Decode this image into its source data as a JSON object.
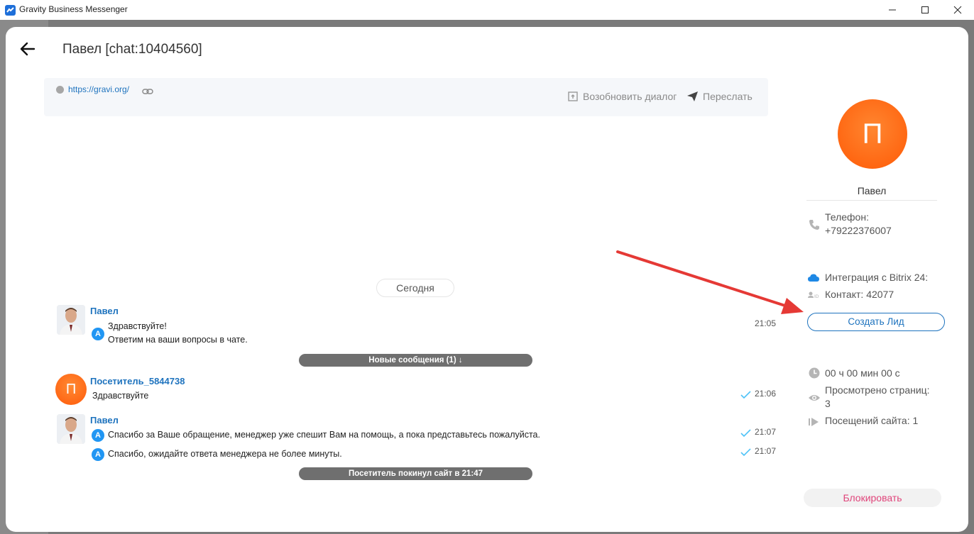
{
  "window": {
    "title": "Gravity Business Messenger"
  },
  "chat": {
    "title": "Павел [chat:10404560]",
    "site_url": "https://gravi.org/",
    "resume_label": "Возобновить диалог",
    "forward_label": "Переслать",
    "date_separator": "Сегодня",
    "messages": [
      {
        "sender": "Павел",
        "lines": [
          "Здравствуйте!",
          "Ответим на ваши вопросы в чате."
        ],
        "badge": "A",
        "time": "21:05"
      },
      {
        "sender": "Посетитель_5844738",
        "avatar_letter": "П",
        "lines": [
          "Здравствуйте"
        ],
        "time": "21:06"
      },
      {
        "sender": "Павел",
        "lines": [
          "Спасибо за Ваше обращение, менеджер уже спешит Вам на помощь, а пока представьтесь пожалуйста."
        ],
        "badge": "A",
        "time": "21:07"
      },
      {
        "lines": [
          "Спасибо, ожидайте ответа менеджера не более минуты."
        ],
        "badge": "A",
        "time": "21:07"
      }
    ],
    "system": {
      "new_messages": "Новые сообщения (1) ↓",
      "visitor_left": "Посетитель покинул сайт в 21:47"
    }
  },
  "profile": {
    "avatar_letter": "П",
    "name": "Павел",
    "phone_label": "Телефон:",
    "phone_value": "+79222376007",
    "integration": "Интеграция с Bitrix 24:",
    "contact": "Контакт: 42077",
    "create_lead": "Создать Лид",
    "time_on_site": "00 ч 00 мин 00 с",
    "pages_viewed_label": "Просмотрено страниц:",
    "pages_viewed_value": "3",
    "visits": "Посещений сайта: 1",
    "block": "Блокировать"
  },
  "colors": {
    "accent": "#1e73be",
    "avatar": "#ff6a14",
    "block": "#e0457b",
    "annotation_arrow": "#e53935",
    "read_check": "#4fc3f7"
  }
}
